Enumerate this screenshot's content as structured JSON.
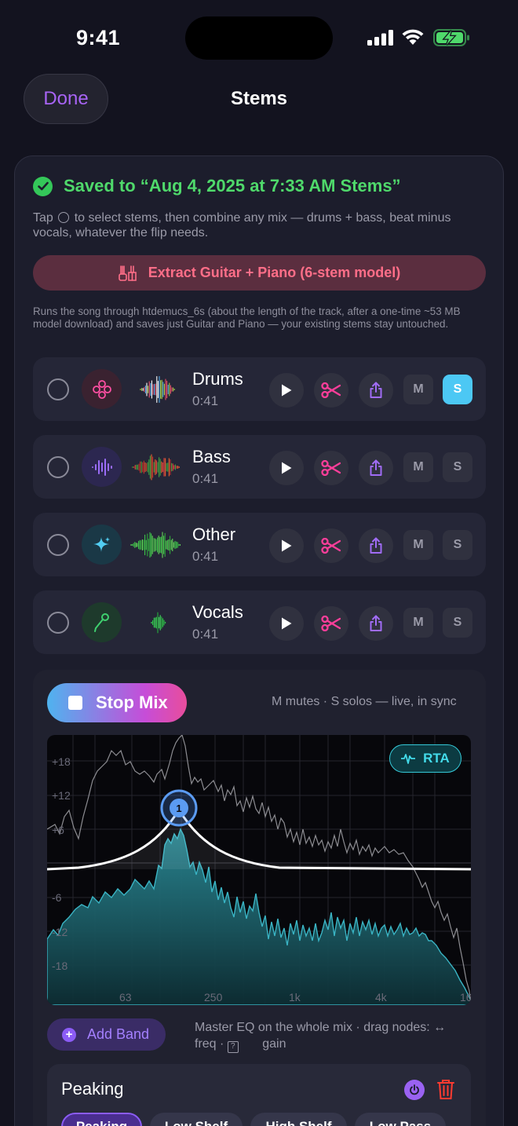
{
  "status": {
    "time": "9:41"
  },
  "nav": {
    "done_label": "Done",
    "title": "Stems"
  },
  "saved": {
    "text": "Saved to “Aug 4, 2025 at 7:33 AM Stems”"
  },
  "description": {
    "before": "Tap",
    "after": "to select stems, then combine any mix — drums + bass, beat minus vocals, whatever the flip needs."
  },
  "extract": {
    "label": "Extract Guitar + Piano (6-stem model)"
  },
  "runs_note": "Runs the song through htdemucs_6s (about the length of the track, after a one-time ~53 MB model download) and saves just Guitar and Piano — your existing stems stay untouched.",
  "stems": [
    {
      "name": "Drums",
      "duration": "0:41",
      "icon": "drums-icon",
      "mute": "M",
      "solo": "S",
      "solo_active": true
    },
    {
      "name": "Bass",
      "duration": "0:41",
      "icon": "waveform-icon",
      "mute": "M",
      "solo": "S",
      "solo_active": false
    },
    {
      "name": "Other",
      "duration": "0:41",
      "icon": "sparkle-icon",
      "mute": "M",
      "solo": "S",
      "solo_active": false
    },
    {
      "name": "Vocals",
      "duration": "0:41",
      "icon": "microphone-icon",
      "mute": "M",
      "solo": "S",
      "solo_active": false
    }
  ],
  "mix": {
    "stop_label": "Stop Mix",
    "hint": "M mutes · S solos — live, in sync"
  },
  "eq": {
    "rta_label": "RTA",
    "db_labels": [
      "+18",
      "+12",
      "+6",
      "-6",
      "-12",
      "-18"
    ],
    "freq_labels": [
      "63",
      "250",
      "1k",
      "4k",
      "16"
    ],
    "node_label": "1"
  },
  "add_band": {
    "label": "Add Band"
  },
  "master_eq": {
    "line1": "Master EQ on the whole mix · drag nodes: ↔",
    "line2_a": "freq ·",
    "line2_b": "gain"
  },
  "band": {
    "type": "Peaking",
    "options": [
      "Peaking",
      "Low Shelf",
      "High Shelf",
      "Low Pass"
    ]
  },
  "colors": {
    "accent": "#a864f5",
    "saved": "#4fd96b",
    "solo_on": "#4cc8f4",
    "scissors": "#ff3e9a",
    "export": "#a06cf5",
    "rta": "#43dbea"
  }
}
